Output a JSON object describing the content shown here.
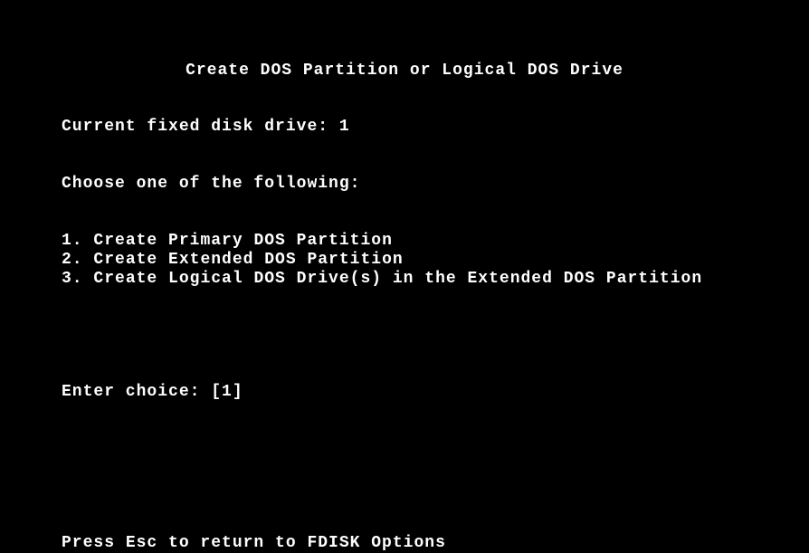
{
  "title": "Create DOS Partition or Logical DOS Drive",
  "current_disk": {
    "label": "Current fixed disk drive: ",
    "value": "1"
  },
  "instruction": "Choose one of the following:",
  "options": [
    {
      "num": "1.",
      "label": "Create Primary DOS Partition"
    },
    {
      "num": "2.",
      "label": "Create Extended DOS Partition"
    },
    {
      "num": "3.",
      "label": "Create Logical DOS Drive(s) in the Extended DOS Partition"
    }
  ],
  "choice": {
    "label": "Enter choice: ",
    "open": "[",
    "value": "1",
    "close": "]"
  },
  "footer": {
    "pre": "Press ",
    "key": "Esc",
    "post": " to return to FDISK Options"
  }
}
